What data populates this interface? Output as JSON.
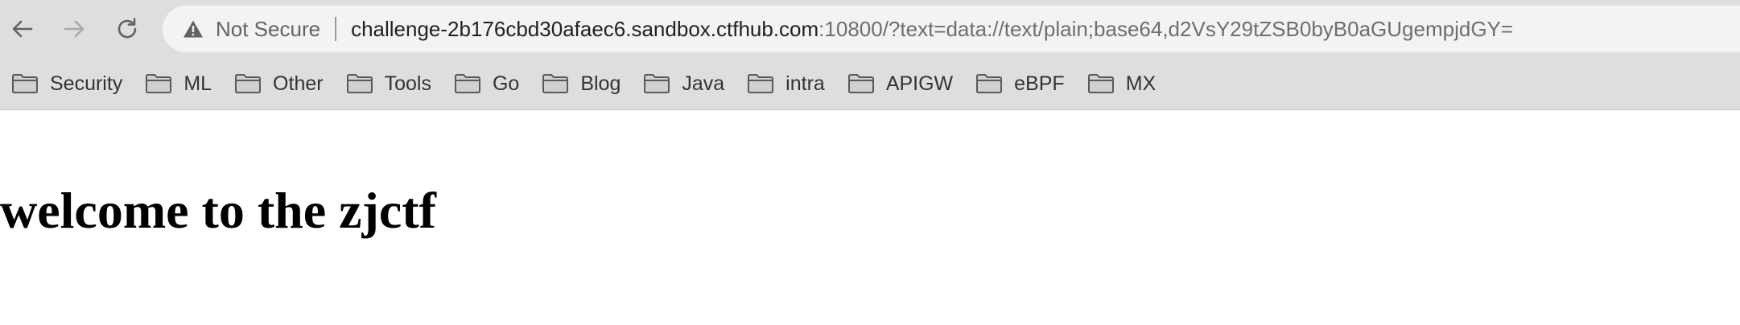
{
  "toolbar": {
    "back_icon": "arrow-left-icon",
    "forward_icon": "arrow-right-icon",
    "reload_icon": "reload-icon"
  },
  "omnibox": {
    "security_icon": "warning-triangle-icon",
    "security_label": "Not Secure",
    "url_host": "challenge-2b176cbd30afaec6.sandbox.ctfhub.com",
    "url_rest": ":10800/?text=data://text/plain;base64,d2VsY29tZSB0byB0aGUgempjdGY="
  },
  "bookmarks": [
    {
      "label": "Security",
      "icon": "folder-icon"
    },
    {
      "label": "ML",
      "icon": "folder-icon"
    },
    {
      "label": "Other",
      "icon": "folder-icon"
    },
    {
      "label": "Tools",
      "icon": "folder-icon"
    },
    {
      "label": "Go",
      "icon": "folder-icon"
    },
    {
      "label": "Blog",
      "icon": "folder-icon"
    },
    {
      "label": "Java",
      "icon": "folder-icon"
    },
    {
      "label": "intra",
      "icon": "folder-icon"
    },
    {
      "label": "APIGW",
      "icon": "folder-icon"
    },
    {
      "label": "eBPF",
      "icon": "folder-icon"
    },
    {
      "label": "MX",
      "icon": "folder-icon"
    }
  ],
  "page": {
    "heading": "welcome to the zjctf"
  },
  "colors": {
    "chrome_bg": "#dedede",
    "omnibox_bg": "#f3f3f3",
    "url_host": "#202124",
    "url_rest": "#6e6e6e",
    "icon": "#5f6368"
  }
}
